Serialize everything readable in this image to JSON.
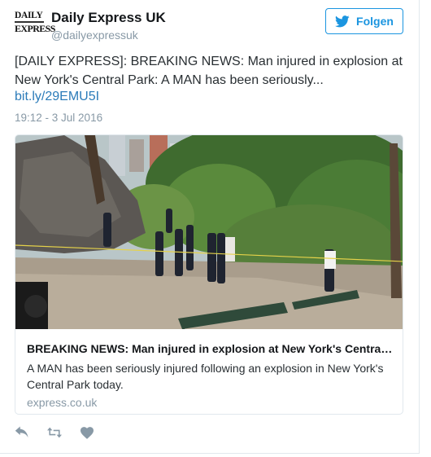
{
  "author": {
    "avatar_line1": "DAILY",
    "avatar_line2": "EXPRESS",
    "display_name": "Daily Express UK",
    "handle": "@dailyexpressuk"
  },
  "follow_button": {
    "label": "Folgen",
    "icon": "twitter-bird-icon"
  },
  "tweet": {
    "text": "[DAILY EXPRESS]: BREAKING NEWS: Man injured in explosion at New York's Central Park: A MAN has been seriously...",
    "link": "bit.ly/29EMU5I",
    "timestamp": "19:12 - 3 Jul 2016"
  },
  "card": {
    "image_alt_icon": "news-photo",
    "title": "BREAKING NEWS: Man injured in explosion at New York's Central Park",
    "description": "A MAN has been seriously injured following an explosion in New York's Central Park today.",
    "domain": "express.co.uk"
  },
  "actions": [
    {
      "name": "reply",
      "icon": "reply-icon"
    },
    {
      "name": "retweet",
      "icon": "retweet-icon"
    },
    {
      "name": "like",
      "icon": "heart-icon"
    }
  ],
  "colors": {
    "accent": "#1b95e0",
    "link": "#2b7bb9",
    "muted": "#8899a6",
    "icon": "#8899a6"
  }
}
